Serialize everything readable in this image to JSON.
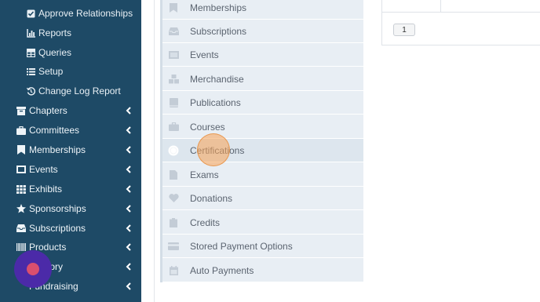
{
  "sidebar": {
    "sub_items": [
      {
        "label": "Approve Relationships",
        "icon": "check-square-icon"
      },
      {
        "label": "Reports",
        "icon": "bar-chart-icon"
      },
      {
        "label": "Queries",
        "icon": "table-icon"
      },
      {
        "label": "Setup",
        "icon": "list-icon"
      },
      {
        "label": "Change Log Report",
        "icon": "history-icon"
      }
    ],
    "items": [
      {
        "label": "Chapters",
        "icon": "archive-icon"
      },
      {
        "label": "Committees",
        "icon": "briefcase-icon"
      },
      {
        "label": "Memberships",
        "icon": "bookmark-icon"
      },
      {
        "label": "Events",
        "icon": "ticket-icon"
      },
      {
        "label": "Exhibits",
        "icon": "grid-icon"
      },
      {
        "label": "Sponsorships",
        "icon": "star-icon"
      },
      {
        "label": "Subscriptions",
        "icon": "inbox-icon"
      },
      {
        "label": "Products",
        "icon": "barcode-icon"
      },
      {
        "label": "tory",
        "icon": "inventory-icon"
      },
      {
        "label": "Fundraising",
        "icon": "gift-icon"
      }
    ]
  },
  "menu": {
    "items": [
      {
        "label": "Memberships",
        "icon": "bookmark-icon"
      },
      {
        "label": "Subscriptions",
        "icon": "inbox-icon"
      },
      {
        "label": "Events",
        "icon": "ticket-icon"
      },
      {
        "label": "Merchandise",
        "icon": "cubes-icon"
      },
      {
        "label": "Publications",
        "icon": "book-icon"
      },
      {
        "label": "Courses",
        "icon": "briefcase-icon"
      },
      {
        "label": "Certifications",
        "icon": "certificate-icon"
      },
      {
        "label": "Exams",
        "icon": "file-icon"
      },
      {
        "label": "Donations",
        "icon": "heart-icon"
      },
      {
        "label": "Credits",
        "icon": "clipboard-icon"
      },
      {
        "label": "Stored Payment Options",
        "icon": "credit-card-icon"
      },
      {
        "label": "Auto Payments",
        "icon": "calendar-icon"
      }
    ],
    "active_index": 6
  },
  "content": {
    "page_number": "1"
  },
  "colors": {
    "sidebar_bg": "#1e4a66",
    "menu_bg": "#e8eef4",
    "highlight": "#f7a356",
    "bubble": "#4b2aa8"
  }
}
